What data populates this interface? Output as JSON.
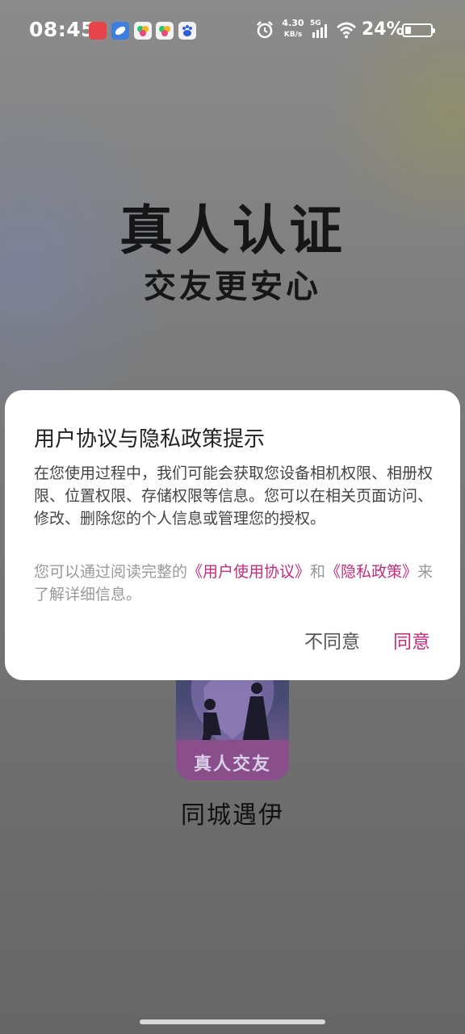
{
  "status_bar": {
    "time": "08:45",
    "net_speed_value": "4.30",
    "net_speed_unit": "KB/s",
    "network_type": "5G",
    "battery_percent": "24%",
    "battery_level": 0.24,
    "notification_icons": [
      "shopping-app-icon",
      "browser-app-icon",
      "colorful-app-icon",
      "colorful-app-icon",
      "baidu-app-icon"
    ]
  },
  "hero": {
    "title": "真人认证",
    "subtitle": "交友更安心"
  },
  "app": {
    "logo_text": "真人交友",
    "name": "同城遇伊"
  },
  "dialog": {
    "title": "用户协议与隐私政策提示",
    "body": "在您使用过程中，我们可能会获取您设备相机权限、相册权限、位置权限、存储权限等信息。您可以在相关页面访问、修改、删除您的个人信息或管理您的授权。",
    "links_prefix": "您可以通过阅读完整的",
    "user_agreement_link": "《用户使用协议》",
    "links_and": "和",
    "privacy_policy_link": "《隐私政策》",
    "links_suffix": "来了解详细信息。",
    "disagree_label": "不同意",
    "agree_label": "同意"
  },
  "colors": {
    "accent": "#c42c7c",
    "overlay": "#6e6e6e"
  }
}
